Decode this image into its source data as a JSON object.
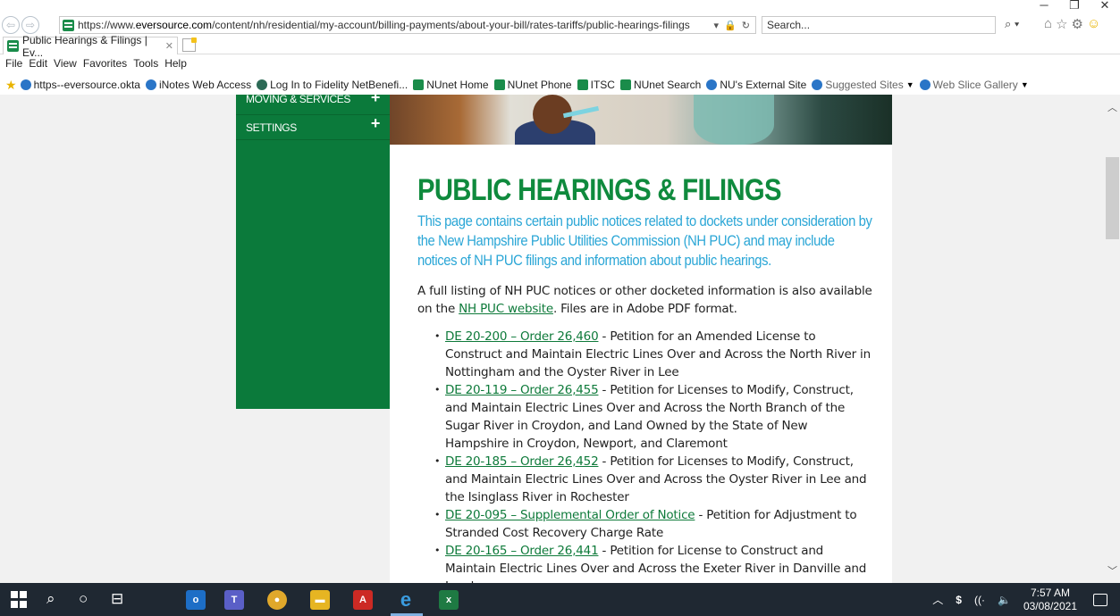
{
  "browser": {
    "url_prefix": "https://www.",
    "url_domain": "eversource.com",
    "url_path": "/content/nh/residential/my-account/billing-payments/about-your-bill/rates-tariffs/public-hearings-filings",
    "search_placeholder": "Search...",
    "tab_title": "Public Hearings & Filings | Ev...",
    "menu": [
      "File",
      "Edit",
      "View",
      "Favorites",
      "Tools",
      "Help"
    ],
    "favorites": [
      {
        "label": "https--eversource.okta",
        "icon": "ie-icon"
      },
      {
        "label": "iNotes Web Access",
        "icon": "ie-icon"
      },
      {
        "label": "Log In to Fidelity NetBenefi...",
        "icon": "fidelity-icon"
      },
      {
        "label": "NUnet Home",
        "icon": "site-icon"
      },
      {
        "label": "NUnet Phone",
        "icon": "site-icon"
      },
      {
        "label": "ITSC",
        "icon": "site-icon"
      },
      {
        "label": "NUnet Search",
        "icon": "site-icon"
      },
      {
        "label": "NU's External Site",
        "icon": "ie-icon"
      }
    ],
    "suggested_sites": "Suggested Sites",
    "web_slice_gallery": "Web Slice Gallery"
  },
  "sidebar": {
    "items": [
      {
        "label": "MOVING & SERVICES"
      },
      {
        "label": "SETTINGS"
      }
    ]
  },
  "page": {
    "title": "PUBLIC HEARINGS & FILINGS",
    "intro": "This page contains certain public notices related to dockets under consideration by the New Hampshire Public Utilities Commission (NH PUC) and may include notices of NH PUC filings and information about public hearings.",
    "lead_before": "A full listing of NH PUC notices or other docketed information is also available on the ",
    "lead_link": "NH PUC website",
    "lead_after": ". Files are in Adobe PDF format.",
    "filings": [
      {
        "link": "DE 20-200 – Order 26,460",
        "text": " - Petition for an Amended License to Construct and Maintain Electric Lines Over and Across the North River in Nottingham and the Oyster River in Lee"
      },
      {
        "link": "DE 20-119 – Order 26,455",
        "text": " - Petition for Licenses to Modify, Construct, and Maintain Electric Lines Over and Across the North Branch of the Sugar River in Croydon, and Land Owned by the State of New Hampshire in Croydon, Newport, and Claremont"
      },
      {
        "link": "DE 20-185 – Order 26,452",
        "text": " - Petition for Licenses to Modify, Construct, and Maintain Electric Lines Over and Across the Oyster River in Lee and the Isinglass River in Rochester"
      },
      {
        "link": "DE 20-095 – Supplemental Order of Notice",
        "text": " - Petition for Adjustment to Stranded Cost Recovery Charge Rate"
      },
      {
        "link": "DE 20-165 – Order 26,441",
        "text": " - Petition for License to Construct and Maintain Electric Lines Over and Across the Exeter River in Danville and Land"
      }
    ]
  },
  "taskbar": {
    "time": "7:57 AM",
    "date": "03/08/2021"
  }
}
